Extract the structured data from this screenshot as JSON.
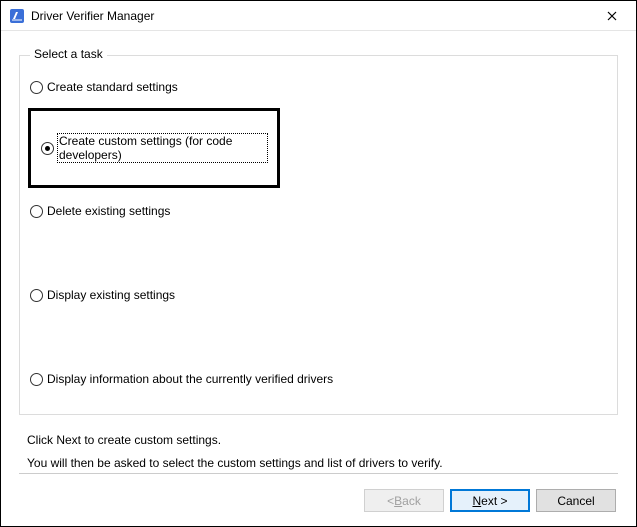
{
  "window": {
    "title": "Driver Verifier Manager"
  },
  "fieldset": {
    "legend": "Select a task",
    "options": {
      "standard": "Create standard settings",
      "custom": "Create custom settings (for code developers)",
      "delete": "Delete existing settings",
      "display": "Display existing settings",
      "info": "Display information about the currently verified drivers"
    },
    "selected": "custom"
  },
  "hints": {
    "line1": "Click Next to create custom settings.",
    "line2": "You will then be asked to select the custom settings and list of drivers to verify."
  },
  "buttons": {
    "back_prefix": "< ",
    "back_u": "B",
    "back_rest": "ack",
    "next_u": "N",
    "next_rest": "ext >",
    "cancel": "Cancel"
  }
}
